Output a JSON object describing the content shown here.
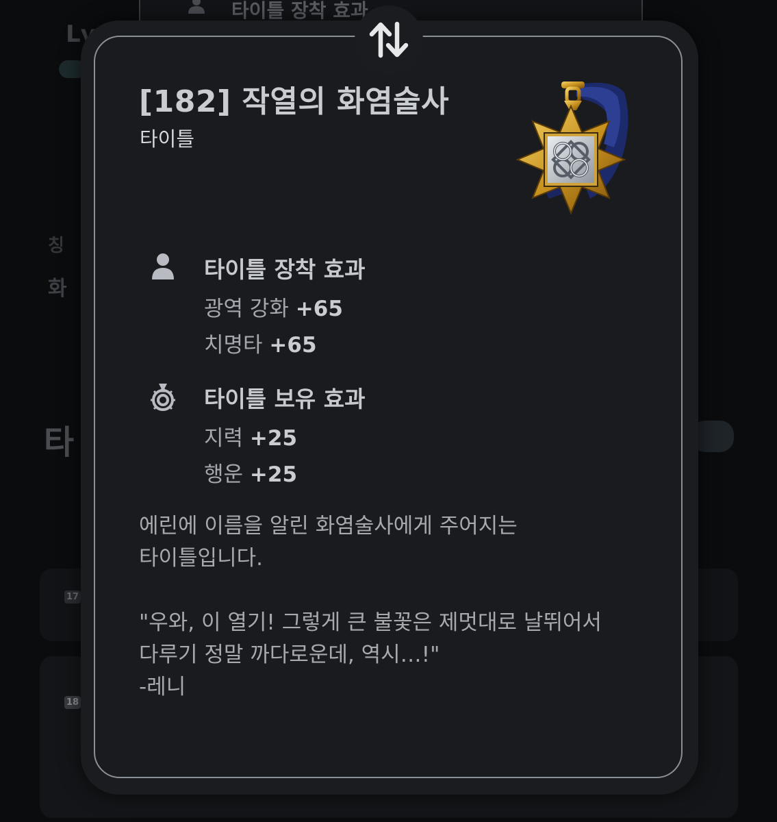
{
  "background": {
    "top_panel_label": "타이틀 장착 효과",
    "left_fragments": [
      "Lv",
      "칭",
      "화",
      "타"
    ],
    "badges": [
      "17",
      "18"
    ]
  },
  "modal": {
    "swap_icon": "swap-vertical-arrows-icon",
    "title": "[182] 작열의 화염술사",
    "subtitle": "타이틀",
    "emblem_icon": "gold-knot-medal-icon",
    "equip_section": {
      "icon": "person-icon",
      "title": "타이틀 장착 효과",
      "stats": [
        {
          "label": "광역 강화 ",
          "value": "+65"
        },
        {
          "label": "치명타 ",
          "value": "+65"
        }
      ]
    },
    "own_section": {
      "icon": "medal-icon",
      "title": "타이틀 보유 효과",
      "stats": [
        {
          "label": "지력 ",
          "value": "+25"
        },
        {
          "label": "행운 ",
          "value": "+25"
        }
      ]
    },
    "description": {
      "line1": "에린에 이름을 알린 화염술사에게 주어지는",
      "line2": "타이틀입니다.",
      "quote1": "\"우와, 이 열기! 그렇게 큰 불꽃은 제멋대로 날뛰어서",
      "quote2": "다루기 정말 까다로운데, 역시…!\"",
      "signature": "-레니"
    }
  },
  "colors": {
    "background": "#0b0c0e",
    "modal_fill": "#1a1b1e",
    "modal_border": "#8a9097",
    "title_text": "#c9ccd1",
    "body_text": "#a6aaaf",
    "emblem_gold": "#d4a93a",
    "emblem_navy": "#1c2a6b"
  }
}
